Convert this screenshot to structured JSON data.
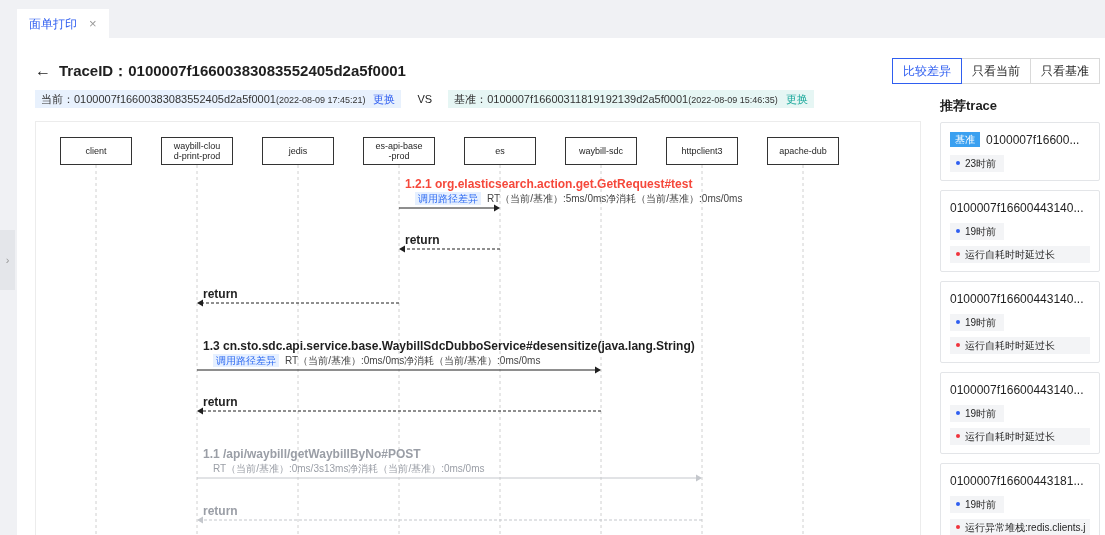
{
  "tabs": [
    {
      "label": "面单打印",
      "close": "×",
      "selected": true
    }
  ],
  "header": {
    "back": "←",
    "label": "TraceID：",
    "trace_id": "0100007f16600383083552405d2a5f0001"
  },
  "view_modes": [
    {
      "label": "比较差异",
      "selected": true
    },
    {
      "label": "只看当前",
      "selected": false
    },
    {
      "label": "只看基准",
      "selected": false
    }
  ],
  "compare": {
    "current": {
      "label": "当前：",
      "id": "0100007f16600383083552405d2a5f0001",
      "time": "(2022-08-09 17:45:21)",
      "action": "更换"
    },
    "vs": "VS",
    "base": {
      "label": "基准：",
      "id": "0100007f16600311819192139d2a5f0001",
      "time": "(2022-08-09 15:46:35)",
      "action": "更换"
    }
  },
  "diagram": {
    "participants": [
      "client",
      "waybill-clou\nd-print-prod",
      "jedis",
      "es-api-base\n-prod",
      "es",
      "waybill-sdc",
      "httpclient3",
      "apache-dub"
    ],
    "messages": [
      {
        "kind": "call",
        "error": true,
        "disabled": false,
        "title": "1.2.1 org.elasticsearch.action.get.GetRequest#test",
        "tag": "调用路径差异",
        "detail": "RT（当前/基准）:5ms/0ms净消耗（当前/基准）:0ms/0ms"
      },
      {
        "kind": "return",
        "error": false,
        "disabled": false,
        "title": "return"
      },
      {
        "kind": "return",
        "error": false,
        "disabled": false,
        "title": "return"
      },
      {
        "kind": "call",
        "error": false,
        "disabled": false,
        "title": "1.3 cn.sto.sdc.api.service.base.WaybillSdcDubboService#desensitize(java.lang.String)",
        "tag": "调用路径差异",
        "detail": "RT（当前/基准）:0ms/0ms净消耗（当前/基准）:0ms/0ms"
      },
      {
        "kind": "return",
        "error": false,
        "disabled": false,
        "title": "return"
      },
      {
        "kind": "call",
        "error": false,
        "disabled": true,
        "title": "1.1 /api/waybill/getWaybillByNo#POST",
        "detail": "RT（当前/基准）:0ms/3s13ms净消耗（当前/基准）:0ms/0ms"
      },
      {
        "kind": "return",
        "error": false,
        "disabled": true,
        "title": "return"
      }
    ]
  },
  "side_toggle": "›",
  "recommend": {
    "title": "推荐trace",
    "cards": [
      {
        "badge": "基准",
        "id": "0100007f16600...",
        "time": "23时前"
      },
      {
        "id": "0100007f16600443140...",
        "time": "19时前",
        "issue": "运行自耗时时延过长"
      },
      {
        "id": "0100007f16600443140...",
        "time": "19时前",
        "issue": "运行自耗时时延过长"
      },
      {
        "id": "0100007f16600443140...",
        "time": "19时前",
        "issue": "运行自耗时时延过长"
      },
      {
        "id": "0100007f16600443181...",
        "time": "19时前",
        "issue": "运行异常堆栈:redis.clients.j"
      }
    ]
  }
}
